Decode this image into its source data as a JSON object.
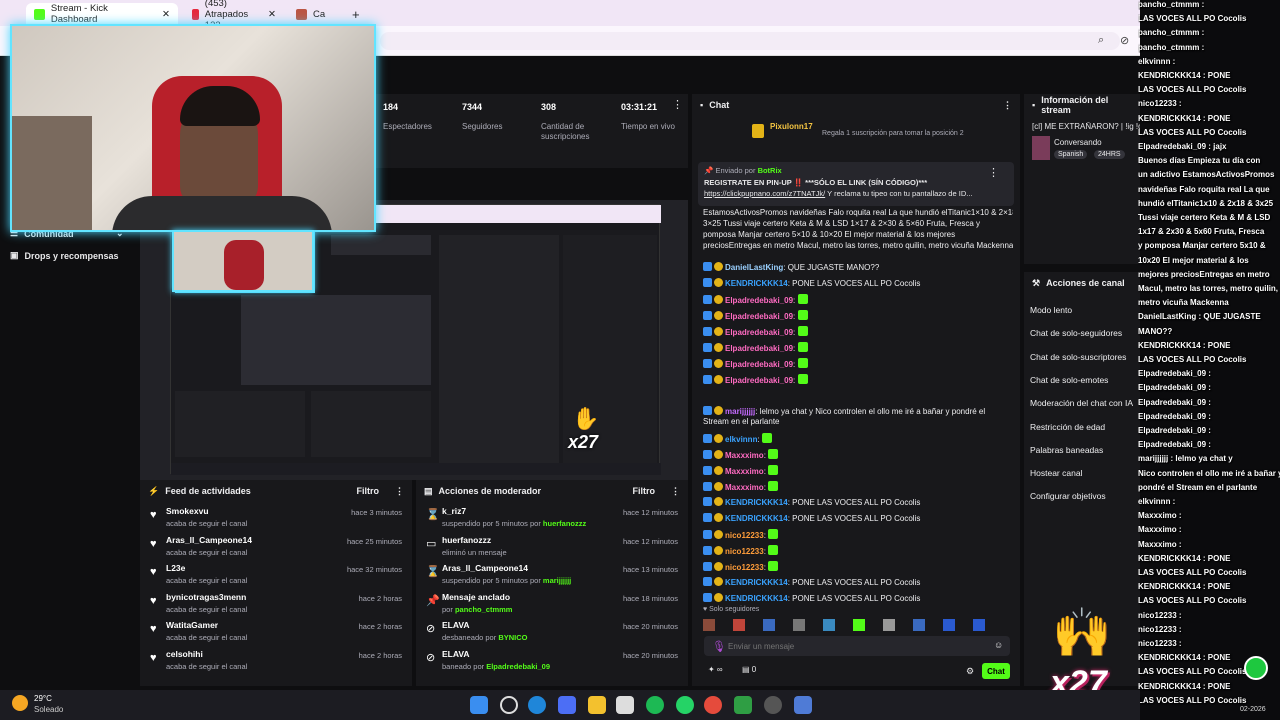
{
  "browser": {
    "tabs": [
      {
        "label": "Stream - Kick Dashboard",
        "active": true
      },
      {
        "label": "(453) Atrapados 133"
      },
      {
        "label": "Ca"
      }
    ],
    "new_tab": "+",
    "close": "✕"
  },
  "sidebar": {
    "items": [
      {
        "label": "Comunidad"
      },
      {
        "label": "Drops y recompensas"
      }
    ]
  },
  "stats": [
    {
      "value": "184",
      "label": "Espectadores"
    },
    {
      "value": "7344",
      "label": "Seguidores"
    },
    {
      "value": "308",
      "label": "Cantidad de suscripciones"
    },
    {
      "value": "03:31:21",
      "label": "Tiempo en vivo"
    }
  ],
  "chat": {
    "title": "Chat",
    "pinned_user": "Pixulonn17",
    "pinned_text": "Regala 1 suscripción para tomar la posición 2",
    "sent_by_label": "Enviado por",
    "bot_name": "BotRix",
    "bot_line1": "REGISTRATE EN PIN-UP ‼️ ***SÓLO EL LINK (SÍN CÓDIGO)***",
    "bot_link": "https://clickpupnano.com/z7TNATJk/",
    "bot_tail": "Y reclama tu tipeo con tu pantallazo de ID...",
    "promo_lines": [
      "EstamosActivosPromos navideñas Falo roquita real La que hundió elTitanic1×10 & 2×18 &",
      "3×25 Tussi viaje certero Keta & M & LSD 1×17 & 2×30 & 5×60 Fruta, Fresca y",
      "pomposa Manjar certero 5×10 & 10×20 El mejor material & los mejores",
      "preciosEntregas en metro Macul, metro las torres, metro quilin, metro vicuña Mackenna"
    ],
    "messages": [
      {
        "user": "DanielLastKing",
        "text": "QUE JUGASTE MANO??"
      },
      {
        "user": "KENDRICKKK14",
        "text": "PONE LAS VOCES ALL PO Cocolis"
      },
      {
        "user": "Elpadredebaki_09",
        "text": ""
      },
      {
        "user": "Elpadredebaki_09",
        "text": ""
      },
      {
        "user": "Elpadredebaki_09",
        "text": ""
      },
      {
        "user": "Elpadredebaki_09",
        "text": ""
      },
      {
        "user": "Elpadredebaki_09",
        "text": ""
      },
      {
        "user": "Elpadredebaki_09",
        "text": ""
      },
      {
        "user": "marijjjjjj",
        "text": "lelmo ya chat y Nico controlen el ollo me iré a bañar y pondré el Stream en el parlante"
      },
      {
        "user": "elkvinnn",
        "text": ""
      },
      {
        "user": "Maxxximo",
        "text": ""
      },
      {
        "user": "Maxxximo",
        "text": ""
      },
      {
        "user": "Maxxximo",
        "text": ""
      },
      {
        "user": "KENDRICKKK14",
        "text": "PONE LAS VOCES ALL PO Cocolis"
      },
      {
        "user": "KENDRICKKK14",
        "text": "PONE LAS VOCES ALL PO Cocolis"
      },
      {
        "user": "nico12233",
        "text": ""
      },
      {
        "user": "nico12233",
        "text": ""
      },
      {
        "user": "nico12233",
        "text": ""
      },
      {
        "user": "KENDRICKKK14",
        "text": "PONE LAS VOCES ALL PO Cocolis"
      },
      {
        "user": "KENDRICKKK14",
        "text": "PONE LAS VOCES ALL PO Cocolis"
      }
    ],
    "followers_only": "Solo seguidores",
    "input_placeholder": "Enviar un mensaje",
    "count": "0",
    "send_label": "Chat"
  },
  "stream_info": {
    "title": "Información del stream",
    "stream_title": "[cl] ME EXTRAÑARON? | !ig !ds !yuccan",
    "category": "Conversando",
    "language": "Spanish",
    "tag": "24HRS"
  },
  "channel_actions": {
    "title": "Acciones de canal",
    "items": [
      "Modo lento",
      "Chat de solo-seguidores",
      "Chat de solo-suscriptores",
      "Chat de solo-emotes",
      "Moderación del chat con IA",
      "Restricción de edad",
      "Palabras baneadas",
      "Hostear canal",
      "Configurar objetivos"
    ]
  },
  "activity_feed": {
    "title": "Feed de actividades",
    "filter": "Filtro",
    "items": [
      {
        "name": "Smokexvu",
        "sub": "acaba de seguir el canal",
        "time": "hace 3 minutos"
      },
      {
        "name": "Aras_ll_Campeone14",
        "sub": "acaba de seguir el canal",
        "time": "hace 25 minutos"
      },
      {
        "name": "L23e",
        "sub": "acaba de seguir el canal",
        "time": "hace 32 minutos"
      },
      {
        "name": "bynicotragas3menn",
        "sub": "acaba de seguir el canal",
        "time": "hace 2 horas"
      },
      {
        "name": "WatitaGamer",
        "sub": "acaba de seguir el canal",
        "time": "hace 2 horas"
      },
      {
        "name": "celsohihi",
        "sub": "acaba de seguir el canal",
        "time": "hace 2 horas"
      }
    ]
  },
  "mod_actions": {
    "title": "Acciones de moderador",
    "filter": "Filtro",
    "items": [
      {
        "name": "k_riz7",
        "sub": "suspendido por 5 minutos por",
        "who": "huerfanozzz",
        "time": "hace 12 minutos"
      },
      {
        "name": "huerfanozzz",
        "sub": "eliminó un mensaje",
        "who": "",
        "time": "hace 12 minutos"
      },
      {
        "name": "Aras_ll_Campeone14",
        "sub": "suspendido por 5 minutos por",
        "who": "marijjjjjj",
        "time": "hace 13 minutos"
      },
      {
        "name": "Mensaje anclado",
        "sub": "por",
        "who": "pancho_ctmmm",
        "time": "hace 18 minutos"
      },
      {
        "name": "ELAVA",
        "sub": "desbaneado por",
        "who": "BYNICO",
        "time": "hace 20 minutos"
      },
      {
        "name": "ELAVA",
        "sub": "baneado por",
        "who": "Elpadredebaki_09",
        "time": "hace 20 minutos"
      }
    ]
  },
  "overlay_chat": [
    "pancho_ctmmm :",
    "LAS VOCES ALL PO Cocolis",
    "pancho_ctmmm :",
    "pancho_ctmmm :",
    "elkvinnn :",
    "KENDRICKKK14 : PONE",
    "LAS VOCES ALL PO Cocolis",
    "nico12233 :",
    "KENDRICKKK14 : PONE",
    "LAS VOCES ALL PO Cocolis",
    "Elpadredebaki_09 : jajx",
    "Buenos días Empieza tu día con",
    "un adictivo EstamosActivosPromos",
    "navideñas Falo roquita real La que",
    "hundió elTitanic1x10 & 2x18 & 3x25",
    "Tussi viaje certero Keta & M & LSD",
    "1x17 & 2x30 & 5x60 Fruta, Fresca",
    "y pomposa Manjar certero 5x10 &",
    "10x20 El mejor material & los",
    "mejores preciosEntregas en metro",
    "Macul, metro las torres, metro quilin,",
    "metro vicuña Mackenna",
    "DanielLastKing : QUE JUGASTE",
    "MANO??",
    "KENDRICKKK14 : PONE",
    "LAS VOCES ALL PO Cocolis",
    "Elpadredebaki_09 :",
    "Elpadredebaki_09 :",
    "Elpadredebaki_09 :",
    "Elpadredebaki_09 :",
    "Elpadredebaki_09 :",
    "Elpadredebaki_09 :",
    "marijjjjjj : lelmo ya chat y",
    "Nico controlen el ollo me iré a bañar y",
    "pondré el Stream en el parlante",
    "elkvinnn :",
    "Maxxximo :",
    "Maxxximo :",
    "Maxxximo :",
    "KENDRICKKK14 : PONE",
    "LAS VOCES ALL PO Cocolis",
    "KENDRICKKK14 : PONE",
    "LAS VOCES ALL PO Cocolis",
    "nico12233 :",
    "nico12233 :",
    "nico12233 :",
    "KENDRICKKK14 : PONE",
    "LAS VOCES ALL PO Cocolis",
    "KENDRICKKK14 : PONE",
    "LAS VOCES ALL PO Cocolis"
  ],
  "x27": "x27",
  "weather": {
    "temp": "29°C",
    "desc": "Soleado"
  },
  "clock": {
    "date": "02-2026"
  },
  "colors": {
    "kick_green": "#53fc18",
    "panel": "#18181b",
    "background": "#0e0e10",
    "cam_border": "#62e4ff"
  }
}
